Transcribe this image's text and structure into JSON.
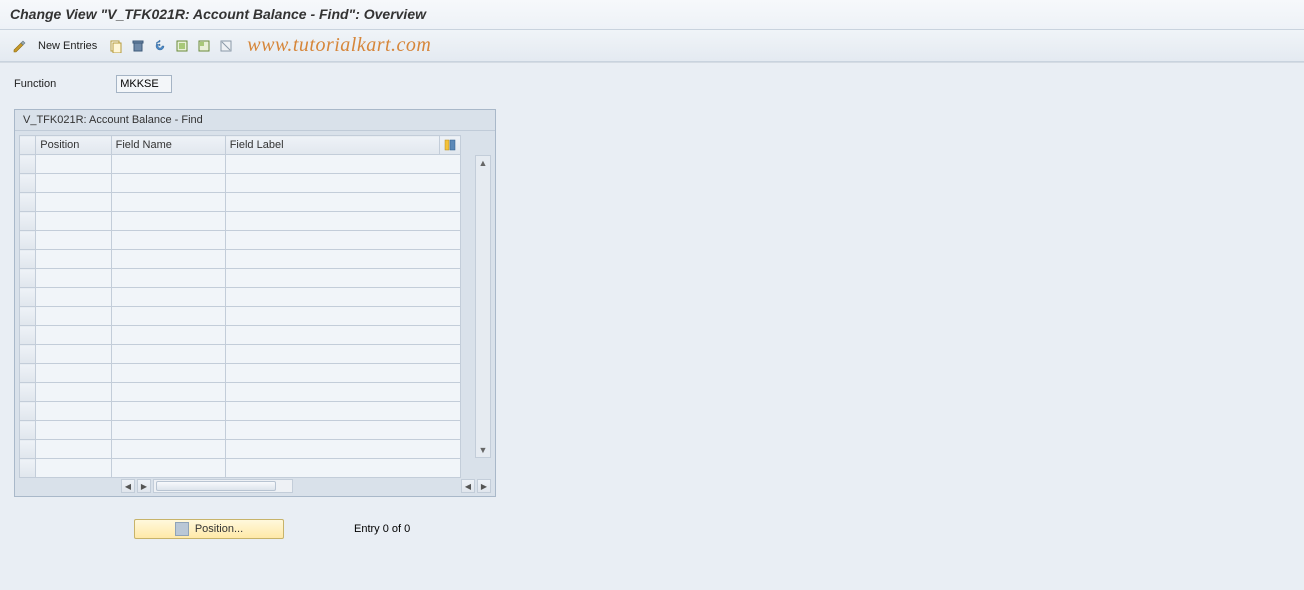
{
  "title": "Change View \"V_TFK021R: Account Balance - Find\": Overview",
  "toolbar": {
    "new_entries_label": "New Entries"
  },
  "watermark": "www.tutorialkart.com",
  "function": {
    "label": "Function",
    "value": "MKKSE"
  },
  "panel": {
    "title": "V_TFK021R: Account Balance - Find",
    "columns": {
      "position": "Position",
      "field_name": "Field Name",
      "field_label": "Field Label"
    },
    "rows": []
  },
  "footer": {
    "position_button": "Position...",
    "entry_text": "Entry 0 of 0"
  }
}
